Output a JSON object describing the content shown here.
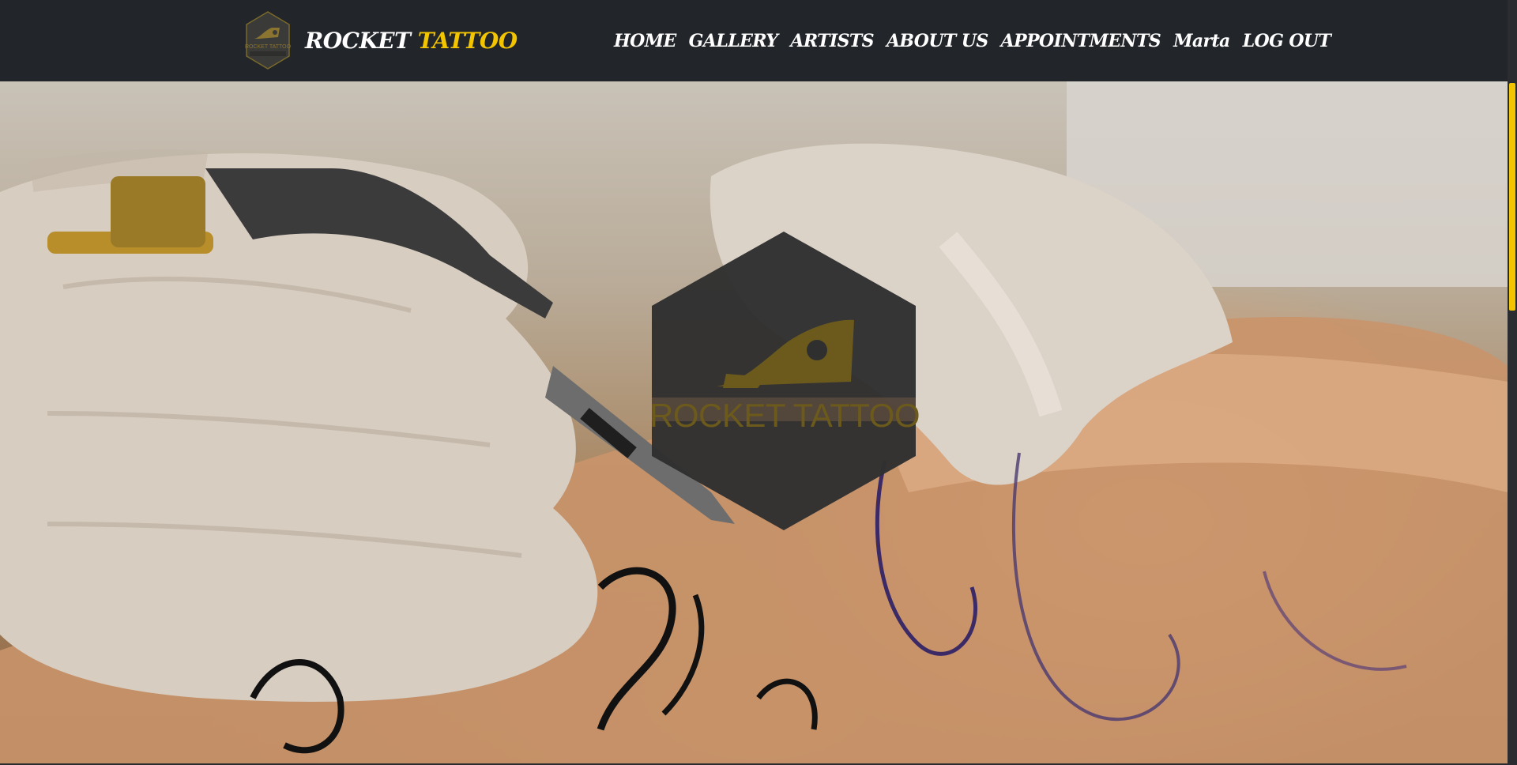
{
  "brand": {
    "name_white": "ROCKET",
    "name_yellow": "TATTOO",
    "logo_icon": "rocket-tattoo-hexagon-logo"
  },
  "nav": {
    "items": [
      {
        "label": "HOME"
      },
      {
        "label": "GALLERY"
      },
      {
        "label": "ARTISTS"
      },
      {
        "label": "ABOUT US"
      },
      {
        "label": "APPOINTMENTS"
      },
      {
        "label": "Marta"
      },
      {
        "label": "LOG OUT"
      }
    ]
  },
  "hero": {
    "emblem_text": "ROCKET TATTOO",
    "image_subject": "tattoo-artist-hands-working"
  },
  "colors": {
    "navbar_bg": "#22252a",
    "accent_yellow": "#f2c500",
    "emblem_dark": "#2f2f2f",
    "emblem_text": "#6b5a1c"
  }
}
